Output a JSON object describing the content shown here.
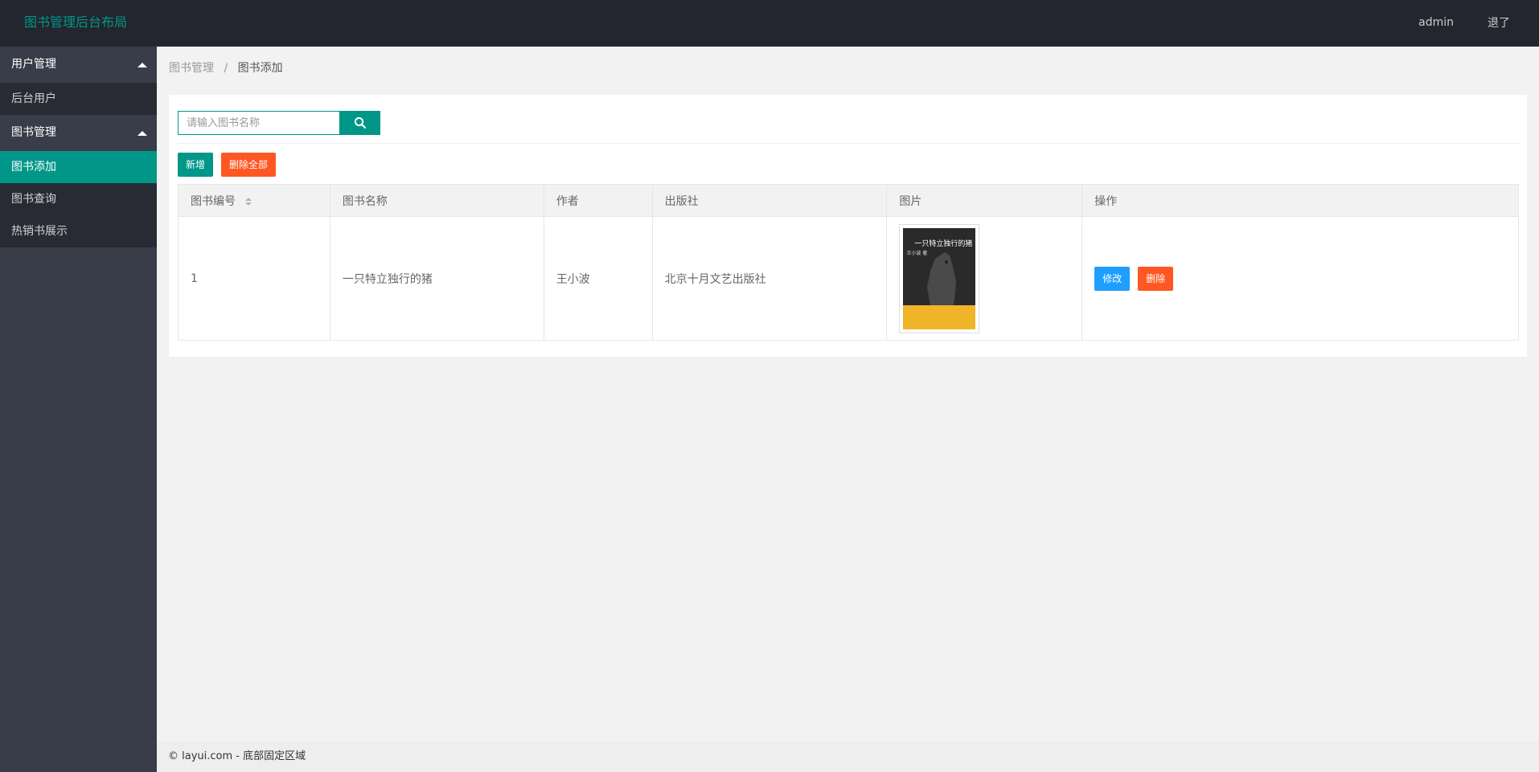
{
  "header": {
    "logo": "图书管理后台布局",
    "user": "admin",
    "logout": "退了"
  },
  "sidebar": {
    "groups": [
      {
        "title": "用户管理",
        "items": [
          {
            "label": "后台用户"
          }
        ]
      },
      {
        "title": "图书管理",
        "items": [
          {
            "label": "图书添加"
          },
          {
            "label": "图书查询"
          },
          {
            "label": "热销书展示"
          }
        ]
      }
    ],
    "active_item": "图书添加"
  },
  "breadcrumb": {
    "parent": "图书管理",
    "separator": "/",
    "current": "图书添加"
  },
  "search": {
    "placeholder": "请输入图书名称",
    "value": ""
  },
  "toolbar": {
    "add_label": "新增",
    "delete_all_label": "删除全部"
  },
  "table": {
    "headers": [
      "图书编号",
      "图书名称",
      "作者",
      "出版社",
      "图片",
      "操作"
    ],
    "rows": [
      {
        "id": "1",
        "name": "一只特立独行的猪",
        "author": "王小波",
        "publisher": "北京十月文艺出版社",
        "cover_title": "一只特立独行的猪",
        "cover_author": "王小波 著",
        "edit_label": "修改",
        "delete_label": "删除"
      }
    ]
  },
  "footer": {
    "text": "© layui.com - 底部固定区域"
  },
  "colors": {
    "primary": "#009688",
    "danger": "#ff5722",
    "info": "#1e9fff",
    "header_bg": "#23262e",
    "sidebar_bg": "#393d49"
  }
}
